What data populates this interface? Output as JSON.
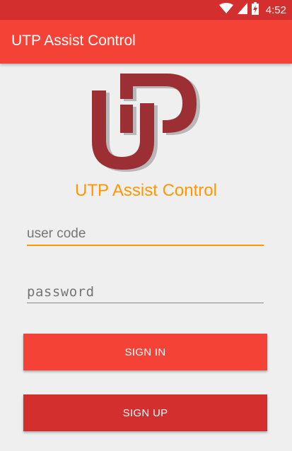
{
  "status_bar": {
    "time": "4:52",
    "icons": [
      "wifi-icon",
      "cellular-signal-icon",
      "battery-charging-icon"
    ]
  },
  "app_bar": {
    "title": "UTP Assist Control"
  },
  "logo": {
    "icon": "utp-logo-icon",
    "colors": {
      "primary": "#9c2f33",
      "shadow": "#b0b0b0"
    }
  },
  "brand_title": "UTP Assist Control",
  "form": {
    "user_code": {
      "value": "",
      "placeholder": "user code"
    },
    "password": {
      "value": "",
      "placeholder": "password"
    }
  },
  "buttons": {
    "sign_in": "SIGN IN",
    "sign_up": "SIGN UP"
  },
  "colors": {
    "status_bar": "#d32f2f",
    "app_bar": "#f44336",
    "accent": "#ff9800",
    "sign_in": "#f44336",
    "sign_up": "#d32f2f",
    "background": "#efefef"
  }
}
